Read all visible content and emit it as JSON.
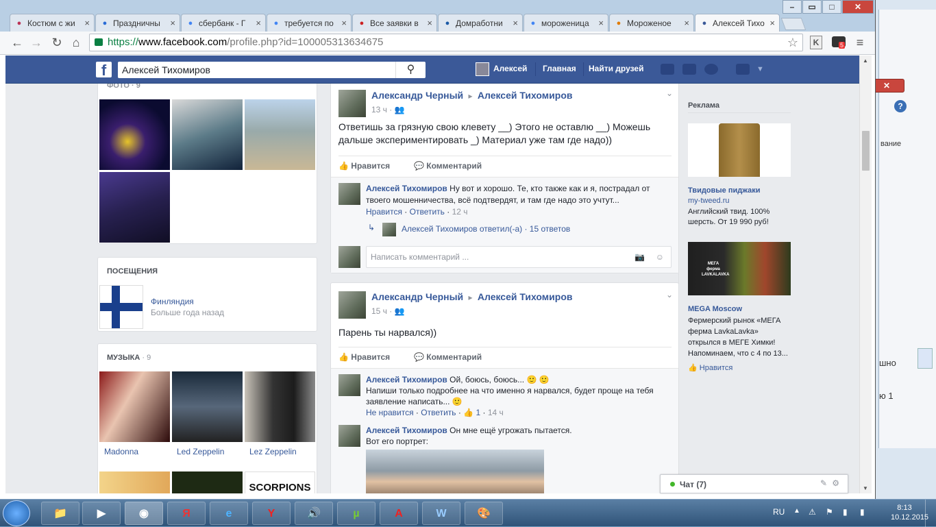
{
  "browser": {
    "tabs": [
      {
        "label": "Костюм с жи",
        "icon": "scissors-icon",
        "color": "#b35"
      },
      {
        "label": "Праздничны",
        "icon": "moon-icon",
        "color": "#2a6cd6"
      },
      {
        "label": "сбербанк - Г",
        "icon": "google-icon",
        "color": "#4285f4"
      },
      {
        "label": "требуется по",
        "icon": "google-icon",
        "color": "#4285f4"
      },
      {
        "label": "Все заявки в",
        "icon": "do-icon",
        "color": "#c22"
      },
      {
        "label": "Домработни",
        "icon": "bird-icon",
        "color": "#1b5aa6"
      },
      {
        "label": "мороженица",
        "icon": "google-icon",
        "color": "#4285f4"
      },
      {
        "label": "Мороженое",
        "icon": "xp-icon",
        "color": "#e07b00"
      },
      {
        "label": "Алексей Тихо",
        "icon": "facebook-icon",
        "color": "#3b5998"
      }
    ],
    "url_scheme": "https://",
    "url_host": "www.facebook.com",
    "url_path": "/profile.php?id=100005313634675",
    "ext_badge": "5"
  },
  "fb": {
    "logo": "f",
    "search_value": "Алексей Тихомиров",
    "user_name": "Алексей",
    "nav_home": "Главная",
    "nav_find_friends": "Найти друзей"
  },
  "left": {
    "photos_label": "ФОТО · 9",
    "visits_title": "ПОСЕЩЕНИЯ",
    "visit_place": "Финляндия",
    "visit_time": "Больше года назад",
    "music_title": "МУЗЫКА",
    "music_count": "· 9",
    "music": [
      "Madonna",
      "Led Zeppelin",
      "Lez Zeppelin"
    ],
    "music_extra": "SCORPIONS"
  },
  "posts": [
    {
      "author": "Александр Черный",
      "arrow": "▸",
      "target": "Алексей Тихомиров",
      "time": "13 ч",
      "text1": "Ответишь за грязную свою клевету __) Этого не оставлю __) Можешь",
      "text2": "дальше экспериментировать _) Материал уже там где надо))",
      "like": "Нравится",
      "comment": "Комментарий",
      "comments": [
        {
          "name": "Алексей Тихомиров",
          "text1": "Ну вот и хорошо. Те, кто также как и я, пострадал от",
          "text2": "твоего мошенничества, всё подтвердят, и там где надо это учтут...",
          "like": "Нравится",
          "reply": "Ответить",
          "time": "12 ч"
        }
      ],
      "replies_name": "Алексей Тихомиров",
      "replies_text": "ответил(-а) · 15 ответов",
      "write_placeholder": "Написать комментарий ..."
    },
    {
      "author": "Александр Черный",
      "arrow": "▸",
      "target": "Алексей Тихомиров",
      "time": "15 ч",
      "text1": "Парень ты нарвался))",
      "like": "Нравится",
      "comment": "Комментарий",
      "comments": [
        {
          "name": "Алексей Тихомиров",
          "text1": "Ой, боюсь, боюсь... 🙂 🙂",
          "text2": "Напиши только подробнее на что именно я нарвался, будет проще на тебя",
          "text3": "заявление написать... 🙂",
          "unlike": "Не нравится",
          "reply": "Ответить",
          "likes": "1",
          "time": "14 ч"
        },
        {
          "name": "Алексей Тихомиров",
          "text1": "Он мне ещё угрожать пытается.",
          "text2": "Вот его портрет:"
        }
      ]
    }
  ],
  "ads": {
    "title": "Реклама",
    "items": [
      {
        "title": "Твидовые пиджаки",
        "site": "my-tweed.ru",
        "text1": "Английский твид. 100%",
        "text2": "шерсть. От 19 990 руб!"
      },
      {
        "title": "MEGA Moscow",
        "text1": "Фермерский рынок «МЕГА",
        "text2": "ферма LavkaLavka»",
        "text3": "открылся в МЕГЕ Химки!",
        "text4": "Напоминаем, что с 4 по 13...",
        "like": "Нравится",
        "banner1": "МЕГА",
        "banner2": "ферма",
        "banner3": "LAVKALAVKA"
      }
    ]
  },
  "chat": {
    "label": "Чат (7)"
  },
  "taskbar": {
    "lang": "RU",
    "time": "8:13",
    "date": "10.12.2015"
  },
  "bgwin": {
    "frag1": "вание",
    "frag2": "шно",
    "frag3": "ю 1"
  }
}
